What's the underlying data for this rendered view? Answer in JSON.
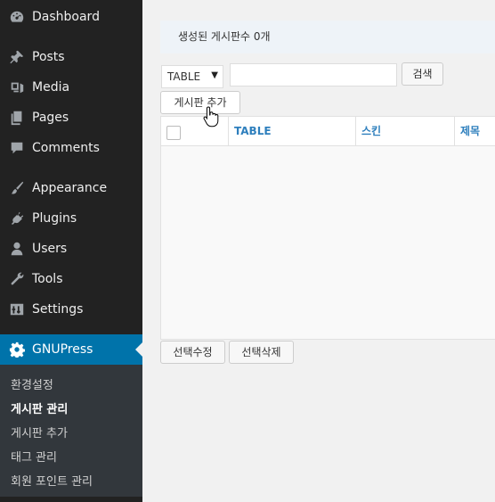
{
  "sidebar": {
    "items": [
      {
        "label": "Dashboard",
        "icon": "dashboard-icon"
      },
      {
        "label": "Posts",
        "icon": "pin-icon"
      },
      {
        "label": "Media",
        "icon": "media-icon"
      },
      {
        "label": "Pages",
        "icon": "pages-icon"
      },
      {
        "label": "Comments",
        "icon": "comment-icon"
      },
      {
        "label": "Appearance",
        "icon": "brush-icon"
      },
      {
        "label": "Plugins",
        "icon": "plug-icon"
      },
      {
        "label": "Users",
        "icon": "user-icon"
      },
      {
        "label": "Tools",
        "icon": "wrench-icon"
      },
      {
        "label": "Settings",
        "icon": "settings-icon"
      },
      {
        "label": "GNUPress",
        "icon": "gear-icon"
      }
    ],
    "submenu": [
      "환경설정",
      "게시판 관리",
      "게시판 추가",
      "태그 관리",
      "회원 포인트 관리"
    ],
    "active_color": "#0073aa",
    "bg_color": "#222222"
  },
  "main": {
    "notice": "생성된 게시판수 0개",
    "filter": {
      "selected": "TABLE",
      "search_value": "",
      "search_button": "검색"
    },
    "add_button": "게시판 추가",
    "table": {
      "headers": [
        "TABLE",
        "스킨",
        "제목"
      ],
      "rows": []
    },
    "bulk_edit_button": "선택수정",
    "bulk_delete_button": "선택삭제"
  }
}
